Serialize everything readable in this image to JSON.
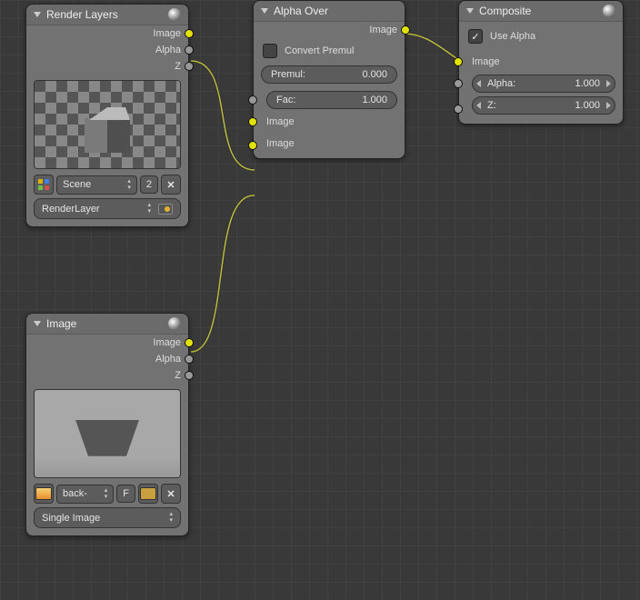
{
  "nodes": {
    "renderLayers": {
      "title": "Render Layers",
      "outputs": {
        "image": "Image",
        "alpha": "Alpha",
        "z": "Z"
      },
      "scene": "Scene",
      "sceneNum": "2",
      "layer": "RenderLayer"
    },
    "image": {
      "title": "Image",
      "outputs": {
        "image": "Image",
        "alpha": "Alpha",
        "z": "Z"
      },
      "file": "back-",
      "fLabel": "F",
      "mode": "Single Image"
    },
    "alphaOver": {
      "title": "Alpha Over",
      "outImage": "Image",
      "convert": "Convert Premul",
      "premulLabel": "Premul:",
      "premulVal": "0.000",
      "facLabel": "Fac:",
      "facVal": "1.000",
      "inImage1": "Image",
      "inImage2": "Image"
    },
    "composite": {
      "title": "Composite",
      "useAlpha": "Use Alpha",
      "inImage": "Image",
      "alphaLabel": "Alpha:",
      "alphaVal": "1.000",
      "zLabel": "Z:",
      "zVal": "1.000"
    }
  }
}
